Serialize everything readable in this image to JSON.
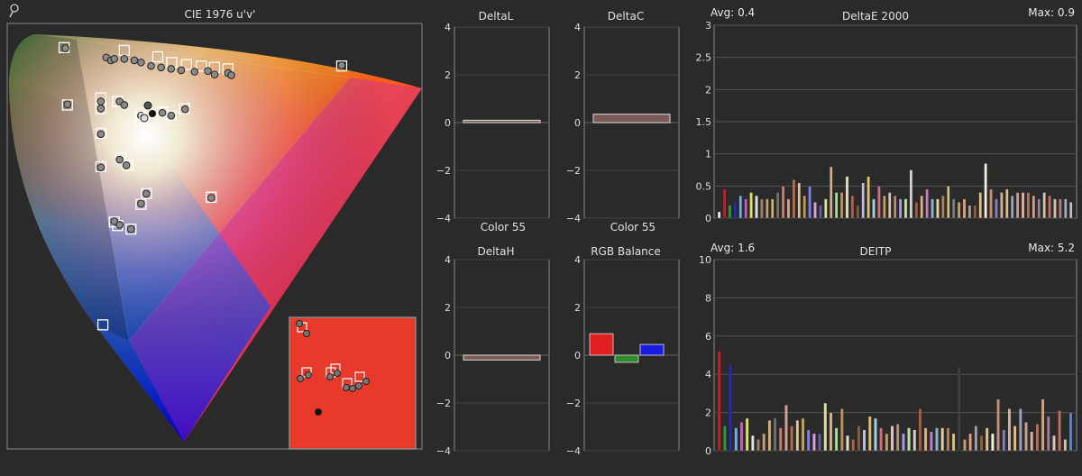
{
  "cie": {
    "title": "CIE 1976 u'v'",
    "magnifier_icon": "magnifier-icon",
    "targets": [
      [
        0.085,
        0.566
      ],
      [
        0.175,
        0.562
      ],
      [
        0.225,
        0.553
      ],
      [
        0.246,
        0.545
      ],
      [
        0.268,
        0.542
      ],
      [
        0.29,
        0.54
      ],
      [
        0.31,
        0.538
      ],
      [
        0.33,
        0.536
      ],
      [
        0.5,
        0.54
      ],
      [
        0.09,
        0.485
      ],
      [
        0.14,
        0.495
      ],
      [
        0.14,
        0.48
      ],
      [
        0.14,
        0.445
      ],
      [
        0.165,
        0.49
      ],
      [
        0.2,
        0.468
      ],
      [
        0.232,
        0.475
      ],
      [
        0.265,
        0.48
      ],
      [
        0.245,
        0.47
      ],
      [
        0.14,
        0.398
      ],
      [
        0.17,
        0.41
      ],
      [
        0.18,
        0.4
      ],
      [
        0.208,
        0.36
      ],
      [
        0.305,
        0.355
      ],
      [
        0.2,
        0.345
      ],
      [
        0.16,
        0.32
      ],
      [
        0.165,
        0.315
      ],
      [
        0.185,
        0.31
      ],
      [
        0.143,
        0.175
      ]
    ],
    "measured": [
      [
        0.087,
        0.565
      ],
      [
        0.148,
        0.552
      ],
      [
        0.155,
        0.548
      ],
      [
        0.16,
        0.55
      ],
      [
        0.175,
        0.55
      ],
      [
        0.19,
        0.548
      ],
      [
        0.2,
        0.545
      ],
      [
        0.215,
        0.54
      ],
      [
        0.23,
        0.538
      ],
      [
        0.245,
        0.536
      ],
      [
        0.26,
        0.534
      ],
      [
        0.28,
        0.532
      ],
      [
        0.3,
        0.533
      ],
      [
        0.31,
        0.528
      ],
      [
        0.33,
        0.53
      ],
      [
        0.335,
        0.527
      ],
      [
        0.5,
        0.541
      ],
      [
        0.09,
        0.486
      ],
      [
        0.14,
        0.49
      ],
      [
        0.14,
        0.48
      ],
      [
        0.14,
        0.444
      ],
      [
        0.168,
        0.49
      ],
      [
        0.175,
        0.485
      ],
      [
        0.2,
        0.47
      ],
      [
        0.232,
        0.474
      ],
      [
        0.266,
        0.479
      ],
      [
        0.245,
        0.47
      ],
      [
        0.14,
        0.397
      ],
      [
        0.168,
        0.408
      ],
      [
        0.178,
        0.4
      ],
      [
        0.208,
        0.36
      ],
      [
        0.305,
        0.354
      ],
      [
        0.2,
        0.346
      ],
      [
        0.16,
        0.321
      ],
      [
        0.168,
        0.316
      ],
      [
        0.185,
        0.31
      ]
    ],
    "white_target": [
      0.172,
      0.47
    ],
    "white_measured": [
      0.176,
      0.474
    ],
    "black_point": [
      0.182,
      0.476
    ]
  },
  "deltaL": {
    "title": "DeltaL",
    "label": "Color 55",
    "value": 0.1,
    "ylim": [
      -4,
      4
    ],
    "ticks": [
      "4",
      "2",
      "0",
      "−2",
      "−4"
    ]
  },
  "deltaC": {
    "title": "DeltaC",
    "label": "Color 55",
    "value": 0.35,
    "ylim": [
      -4,
      4
    ],
    "ticks": [
      "4",
      "2",
      "0",
      "−2",
      "−4"
    ]
  },
  "deltaH": {
    "title": "DeltaH",
    "value": -0.2,
    "ylim": [
      -4,
      4
    ],
    "ticks": [
      "4",
      "2",
      "0",
      "−2",
      "−4"
    ]
  },
  "rgb_balance": {
    "title": "RGB Balance",
    "ylim": [
      -4,
      4
    ],
    "ticks": [
      "4",
      "2",
      "0",
      "−2",
      "−4"
    ],
    "values": [
      0.9,
      -0.3,
      0.45
    ],
    "colors": [
      "#e02020",
      "#2e8b2e",
      "#1a1ae0"
    ]
  },
  "chart_data": [
    {
      "type": "bar",
      "title": "DeltaE 2000",
      "avg_label": "Avg: 0.4",
      "max_label": "Max: 0.9",
      "ylim": [
        0,
        3
      ],
      "yticks": [
        "0",
        "0.5",
        "1",
        "1.5",
        "2",
        "2.5",
        "3"
      ],
      "grid": true,
      "values": [
        0.1,
        0.45,
        0.2,
        0.25,
        0.35,
        0.3,
        0.4,
        0.35,
        0.3,
        0.3,
        0.3,
        0.4,
        0.5,
        0.3,
        0.6,
        0.55,
        0.35,
        0.5,
        0.25,
        0.2,
        0.3,
        0.8,
        0.4,
        0.4,
        0.65,
        0.35,
        0.2,
        0.55,
        0.65,
        0.3,
        0.5,
        0.35,
        0.4,
        0.35,
        0.3,
        0.3,
        0.75,
        0.25,
        0.35,
        0.45,
        0.3,
        0.3,
        0.35,
        0.5,
        0.3,
        0.25,
        0.3,
        0.2,
        0.2,
        0.4,
        0.85,
        0.45,
        0.3,
        0.4,
        0.45,
        0.35,
        0.4,
        0.4,
        0.4,
        0.35,
        0.3,
        0.4,
        0.35,
        0.3,
        0.3,
        0.3,
        0.25
      ],
      "colors": [
        "#e8e8e8",
        "#c0202a",
        "#2a9a3a",
        "#2a2ab0",
        "#6fb3e0",
        "#c060c0",
        "#e0e060",
        "#e0e0e0",
        "#a08060",
        "#c0a080",
        "#d0b070",
        "#707070",
        "#c08070",
        "#d0a090",
        "#b07050",
        "#e0c0a0",
        "#c0a050",
        "#8080e0",
        "#e0a0e0",
        "#6060a0",
        "#e0e0a0",
        "#d0b090",
        "#a0e0a0",
        "#c09060",
        "#e0e0c0",
        "#b06050",
        "#806040",
        "#c0c0e0",
        "#e0c070",
        "#a0d0e0",
        "#d07080",
        "#c0a060",
        "#e0c0c0",
        "#b09070",
        "#a0a0e0",
        "#c0e0a0",
        "#d0d0d0",
        "#a06040",
        "#e0b080",
        "#c080c0",
        "#90b0d0",
        "#e0d0a0",
        "#b08060",
        "#d0c080",
        "#708090",
        "#c0a070",
        "#e0a080",
        "#a0a0a0",
        "#906030",
        "#e0c090",
        "#f0f0e0",
        "#c09070",
        "#8080c0",
        "#d0b0a0",
        "#e0c080",
        "#a0a0c0",
        "#c0a090",
        "#e0b0a0",
        "#b07060",
        "#d0a080",
        "#a08090",
        "#e0c0b0",
        "#c07060",
        "#d0c0b0",
        "#b08080",
        "#a0b0c0",
        "#c0c0c0"
      ]
    },
    {
      "type": "bar",
      "title": "DEITP",
      "avg_label": "Avg: 1.6",
      "max_label": "Max: 5.2",
      "ylim": [
        0,
        10
      ],
      "yticks": [
        "0",
        "2",
        "4",
        "6",
        "8",
        "10"
      ],
      "grid": true,
      "values": [
        5.2,
        1.3,
        4.5,
        1.2,
        1.5,
        1.7,
        0.8,
        0.6,
        0.9,
        1.6,
        1.7,
        1.2,
        2.4,
        1.3,
        1.6,
        1.7,
        1.1,
        0.9,
        0.9,
        2.5,
        2.0,
        1.2,
        2.2,
        0.8,
        0.6,
        1.3,
        1.1,
        1.8,
        1.7,
        1.2,
        0.9,
        1.3,
        1.4,
        0.9,
        1.2,
        1.1,
        2.2,
        1.2,
        1.0,
        1.2,
        1.2,
        1.2,
        0.9,
        4.4,
        0.6,
        0.9,
        1.3,
        0.8,
        1.2,
        0.9,
        2.7,
        1.1,
        2.2,
        1.3,
        2.2,
        1.5,
        1.0,
        1.4,
        2.7,
        1.8,
        0.8,
        2.1,
        0.6,
        2.0
      ],
      "colors": [
        "#c0202a",
        "#2a9a3a",
        "#2a2ab0",
        "#6fb3e0",
        "#c060c0",
        "#e0e060",
        "#e0e0e0",
        "#a08060",
        "#c0a080",
        "#d0b070",
        "#707070",
        "#c08070",
        "#d0a090",
        "#b07050",
        "#e0c0a0",
        "#c0a050",
        "#8080e0",
        "#e0a0e0",
        "#6060a0",
        "#e0e0a0",
        "#d0b090",
        "#a0e0a0",
        "#c09060",
        "#e0e0c0",
        "#b06050",
        "#806040",
        "#c0c0e0",
        "#e0c070",
        "#a0d0e0",
        "#d07080",
        "#c0a060",
        "#e0c0c0",
        "#b09070",
        "#a0a0e0",
        "#c0e0a0",
        "#d0d0d0",
        "#a06040",
        "#e0b080",
        "#c080c0",
        "#90b0d0",
        "#e0d0a0",
        "#b08060",
        "#d0c080",
        "#404040",
        "#c0a070",
        "#e0a080",
        "#a0a0a0",
        "#906030",
        "#e0c090",
        "#f0f0e0",
        "#c09070",
        "#8080c0",
        "#d0b0a0",
        "#e0c080",
        "#a0a0c0",
        "#c0a090",
        "#e0b0a0",
        "#b07060",
        "#d0a080",
        "#a08090",
        "#e0c0b0",
        "#c07060",
        "#d0c0b0",
        "#6080c0"
      ]
    }
  ]
}
